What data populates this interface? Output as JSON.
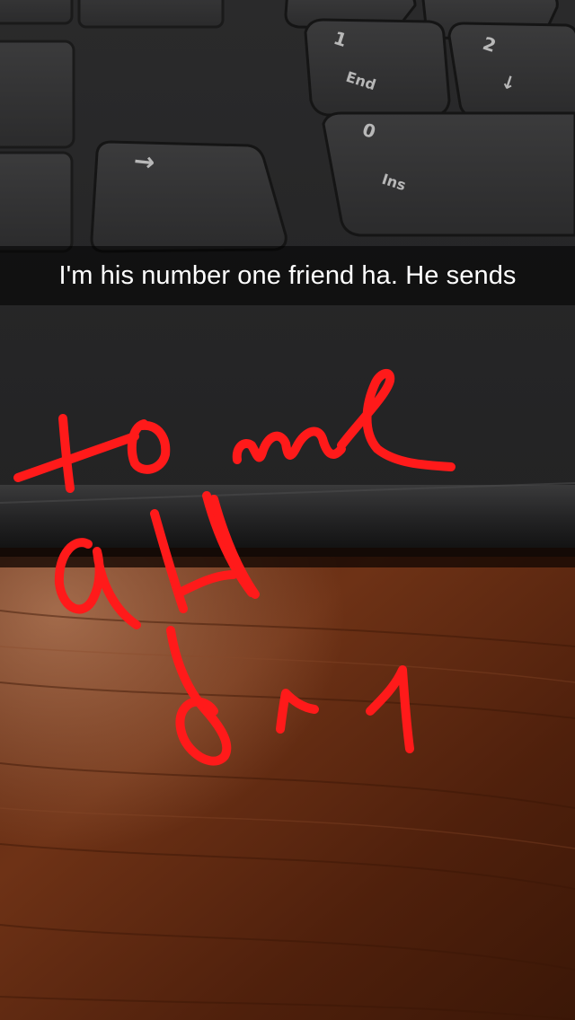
{
  "snap": {
    "caption": "I'm his number one friend ha. He sends",
    "drawing_color": "#ff1a1a"
  },
  "keyboard": {
    "keys": [
      {
        "name": "numpad-1-end-key",
        "legend": "1",
        "sub_legend": "End"
      },
      {
        "name": "numpad-2-down-key",
        "legend": "2",
        "sub_legend": "↓"
      },
      {
        "name": "numpad-0-ins-key",
        "legend": "0",
        "sub_legend": "Ins"
      },
      {
        "name": "right-arrow-key",
        "legend": "→",
        "sub_legend": ""
      }
    ]
  }
}
